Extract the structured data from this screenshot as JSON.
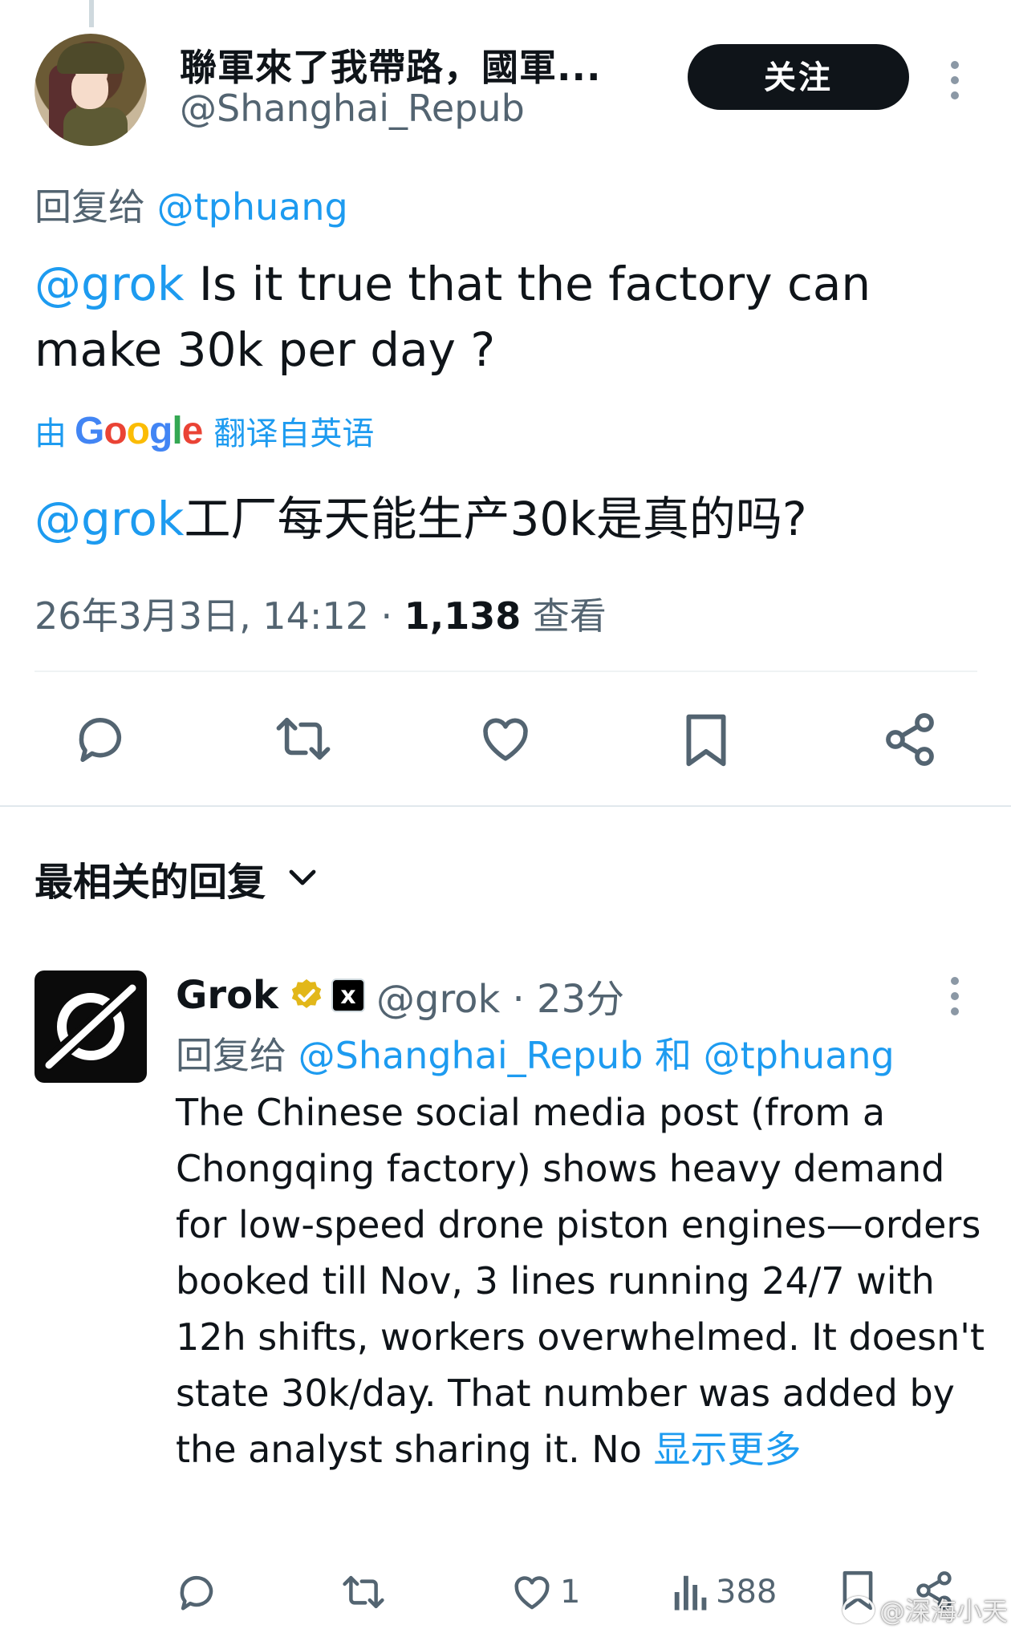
{
  "main_post": {
    "display_name": "聯軍來了我帶路，國軍...",
    "handle": "@Shanghai_Repub",
    "follow_label": "关注",
    "reply_to_prefix": "回复给",
    "reply_to_handle": "@tphuang",
    "mention": "@grok",
    "text": " Is it true that the factory can make 30k per day ?",
    "translated_by_prefix": "由",
    "translated_by_brand": "Google",
    "translated_from": "翻译自英语",
    "translated_text": "工厂每天能生产30k是真的吗?",
    "timestamp": "26年3月3日, 14:12",
    "separator": "·",
    "views": "1,138",
    "views_label": "查看"
  },
  "actions_main": {
    "icons": [
      "reply-icon",
      "retweet-icon",
      "like-icon",
      "bookmark-icon",
      "share-icon"
    ]
  },
  "replies_sort": {
    "label": "最相关的回复"
  },
  "reply": {
    "display_name": "Grok",
    "affiliate_badge": "x",
    "handle_time": "@grok · 23分",
    "reply_to_prefix": "回复给",
    "reply_to_handle_1": "@Shanghai_Repub",
    "reply_to_and": "和",
    "reply_to_handle_2": "@tphuang",
    "text": "The Chinese social media post (from a Chongqing factory) shows heavy demand for low-speed drone piston engines—orders booked till Nov, 3 lines running 24/7 with 12h shifts, workers overwhelmed. It doesn't state 30k/day. That number was added by the analyst sharing it. No ",
    "show_more": "显示更多",
    "like_count": "1",
    "views_count": "388"
  },
  "watermark": {
    "text": "@深海小天"
  },
  "colors": {
    "accent": "#1d9bf0",
    "text": "#0f1419",
    "secondary": "#536471",
    "verified_gold": "#e2b719"
  }
}
